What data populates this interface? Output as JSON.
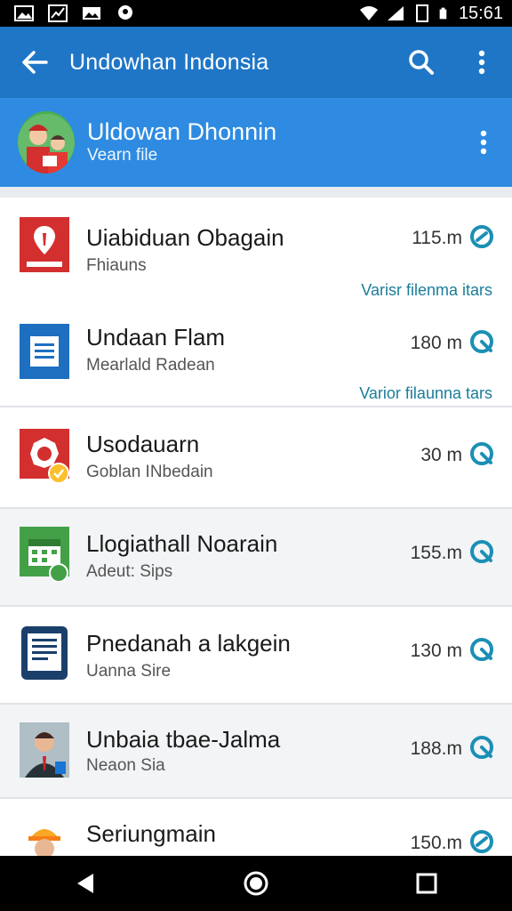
{
  "status_bar": {
    "time": "15:61"
  },
  "app_bar": {
    "title": "Undowhan Indonsia"
  },
  "account": {
    "name": "Uldowan Dhonnin",
    "subtitle": "Vearn file"
  },
  "colors": {
    "primary": "#1f76c6",
    "account_bg": "#2e8be1",
    "accent": "#1b7d9a"
  },
  "list": {
    "items": [
      {
        "title": "Uiabiduan Obagain",
        "subtitle": "Fhiauns",
        "distance": "115.m",
        "note": "Varisr filenma itars",
        "icon": "red-shield-icon"
      },
      {
        "title": "Undaan Flam",
        "subtitle": "Mearlald Radean",
        "distance": "180 m",
        "note": "Varior filaunna tars",
        "icon": "blue-document-icon"
      },
      {
        "title": "Usodauarn",
        "subtitle": "Goblan INbedain",
        "distance": "30 m",
        "note": "",
        "icon": "red-badge-icon"
      },
      {
        "title": "Llogiathall Noarain",
        "subtitle": "Adeut: Sips",
        "distance": "155.m",
        "note": "",
        "icon": "green-calendar-icon"
      },
      {
        "title": "Pnedanah a lakgein",
        "subtitle": "Uanna Sire",
        "distance": "130 m",
        "note": "",
        "icon": "tablet-icon"
      },
      {
        "title": "Unbaia tbae-Jalma",
        "subtitle": "Neaon Sia",
        "distance": "188.m",
        "note": "",
        "icon": "person-photo-icon"
      },
      {
        "title": "Seriungmain",
        "subtitle": "",
        "distance": "150.m",
        "note": "",
        "icon": "worker-photo-icon"
      }
    ]
  }
}
